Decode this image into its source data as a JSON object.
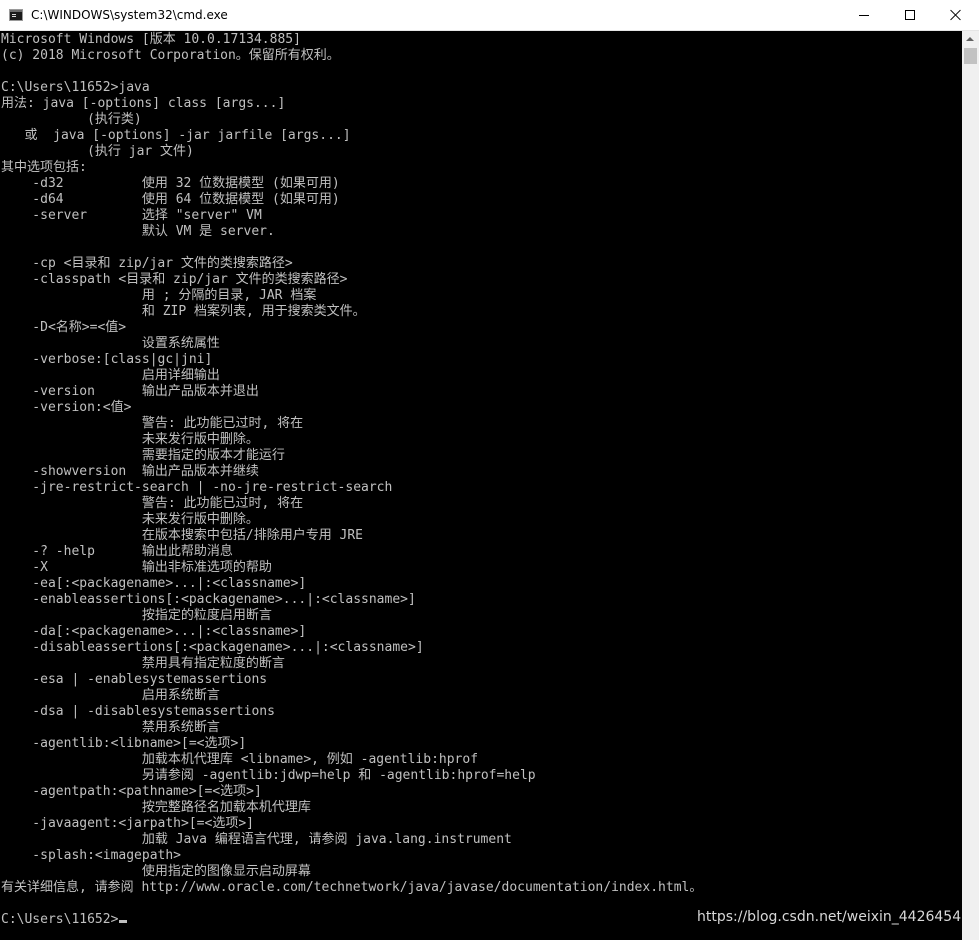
{
  "window": {
    "title": "C:\\WINDOWS\\system32\\cmd.exe",
    "icon": "console-icon",
    "controls": {
      "minimize_icon": "minimize-icon",
      "maximize_icon": "maximize-icon",
      "close_icon": "close-icon"
    }
  },
  "console": {
    "text_color": "#c0c0c0",
    "background": "#000000",
    "lines": [
      "Microsoft Windows [版本 10.0.17134.885]",
      "(c) 2018 Microsoft Corporation。保留所有权利。",
      "",
      "C:\\Users\\11652>java",
      "用法: java [-options] class [args...]",
      "           (执行类)",
      "   或  java [-options] -jar jarfile [args...]",
      "           (执行 jar 文件)",
      "其中选项包括:",
      "    -d32          使用 32 位数据模型 (如果可用)",
      "    -d64          使用 64 位数据模型 (如果可用)",
      "    -server       选择 \"server\" VM",
      "                  默认 VM 是 server.",
      "",
      "    -cp <目录和 zip/jar 文件的类搜索路径>",
      "    -classpath <目录和 zip/jar 文件的类搜索路径>",
      "                  用 ; 分隔的目录, JAR 档案",
      "                  和 ZIP 档案列表, 用于搜索类文件。",
      "    -D<名称>=<值>",
      "                  设置系统属性",
      "    -verbose:[class|gc|jni]",
      "                  启用详细输出",
      "    -version      输出产品版本并退出",
      "    -version:<值>",
      "                  警告: 此功能已过时, 将在",
      "                  未来发行版中删除。",
      "                  需要指定的版本才能运行",
      "    -showversion  输出产品版本并继续",
      "    -jre-restrict-search | -no-jre-restrict-search",
      "                  警告: 此功能已过时, 将在",
      "                  未来发行版中删除。",
      "                  在版本搜索中包括/排除用户专用 JRE",
      "    -? -help      输出此帮助消息",
      "    -X            输出非标准选项的帮助",
      "    -ea[:<packagename>...|:<classname>]",
      "    -enableassertions[:<packagename>...|:<classname>]",
      "                  按指定的粒度启用断言",
      "    -da[:<packagename>...|:<classname>]",
      "    -disableassertions[:<packagename>...|:<classname>]",
      "                  禁用具有指定粒度的断言",
      "    -esa | -enablesystemassertions",
      "                  启用系统断言",
      "    -dsa | -disablesystemassertions",
      "                  禁用系统断言",
      "    -agentlib:<libname>[=<选项>]",
      "                  加载本机代理库 <libname>, 例如 -agentlib:hprof",
      "                  另请参阅 -agentlib:jdwp=help 和 -agentlib:hprof=help",
      "    -agentpath:<pathname>[=<选项>]",
      "                  按完整路径名加载本机代理库",
      "    -javaagent:<jarpath>[=<选项>]",
      "                  加载 Java 编程语言代理, 请参阅 java.lang.instrument",
      "    -splash:<imagepath>",
      "                  使用指定的图像显示启动屏幕",
      "有关详细信息, 请参阅 http://www.oracle.com/technetwork/java/javase/documentation/index.html。",
      ""
    ],
    "prompt": "C:\\Users\\11652>"
  },
  "watermark": "https://blog.csdn.net/weixin_4426454"
}
